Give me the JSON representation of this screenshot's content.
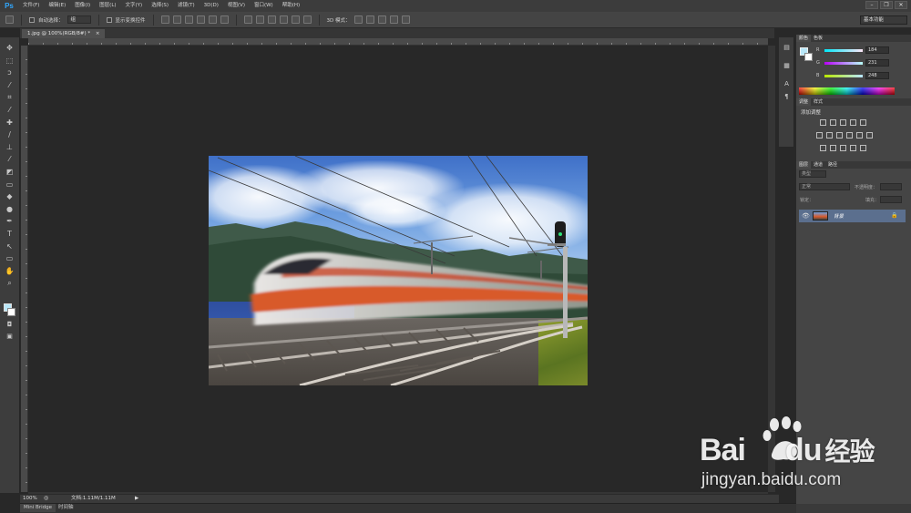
{
  "app": {
    "logo": "Ps",
    "menu": [
      "文件(F)",
      "编辑(E)",
      "图像(I)",
      "图层(L)",
      "文字(Y)",
      "选择(S)",
      "滤镜(T)",
      "3D(D)",
      "视图(V)",
      "窗口(W)",
      "帮助(H)"
    ],
    "window_controls": [
      "–",
      "❐",
      "✕"
    ]
  },
  "options": {
    "auto_select_label": "自动选择：",
    "auto_select_value": "组",
    "show_transform_label": "显示变换控件",
    "mode_3d_label": "3D 模式：",
    "workspace": "基本功能"
  },
  "document": {
    "tab_title": "1.jpg @ 100%(RGB/8#) *",
    "tab_close": "×"
  },
  "tools": [
    {
      "name": "move-tool",
      "glyph": "✥"
    },
    {
      "name": "marquee-tool",
      "glyph": "⬚"
    },
    {
      "name": "lasso-tool",
      "glyph": "ↄ"
    },
    {
      "name": "quick-select-tool",
      "glyph": "⁄"
    },
    {
      "name": "crop-tool",
      "glyph": "⌗"
    },
    {
      "name": "eyedropper-tool",
      "glyph": "⁄"
    },
    {
      "name": "healing-brush-tool",
      "glyph": "✚"
    },
    {
      "name": "brush-tool",
      "glyph": "∕"
    },
    {
      "name": "clone-stamp-tool",
      "glyph": "⊥"
    },
    {
      "name": "history-brush-tool",
      "glyph": "⁄"
    },
    {
      "name": "eraser-tool",
      "glyph": "◩"
    },
    {
      "name": "gradient-tool",
      "glyph": "▭"
    },
    {
      "name": "blur-tool",
      "glyph": "◆"
    },
    {
      "name": "dodge-tool",
      "glyph": "●"
    },
    {
      "name": "pen-tool",
      "glyph": "✒"
    },
    {
      "name": "type-tool",
      "glyph": "T"
    },
    {
      "name": "path-select-tool",
      "glyph": "↖"
    },
    {
      "name": "shape-tool",
      "glyph": "▭"
    },
    {
      "name": "hand-tool",
      "glyph": "✋"
    },
    {
      "name": "zoom-tool",
      "glyph": "⌕"
    }
  ],
  "colors": {
    "foreground": "#b8e7f8",
    "background": "#ffffff",
    "accent": "#31a8ff"
  },
  "color_panel": {
    "tabs": [
      "颜色",
      "色板"
    ],
    "r_label": "R",
    "r_value": "184",
    "g_label": "G",
    "g_value": "231",
    "b_label": "B",
    "b_value": "248"
  },
  "adjust_panel": {
    "tabs": [
      "调整",
      "样式"
    ],
    "add_label": "添加调整"
  },
  "layers_panel": {
    "tabs": [
      "图层",
      "通道",
      "路径"
    ],
    "filter_label": "类型",
    "blend_mode": "正常",
    "opacity_label": "不透明度：",
    "lock_label": "锁定：",
    "fill_label": "填充：",
    "layer_name": "背景"
  },
  "status": {
    "zoom": "100%",
    "doc_info": "文档:1.11M/1.11M",
    "arrow": "▶"
  },
  "bottom_tabs": [
    "Mini Bridge",
    "时间轴"
  ],
  "watermark": {
    "url": "jingyan.baidu.com",
    "brand": "Bai",
    "brand_suffix": "du",
    "product": "经验"
  }
}
